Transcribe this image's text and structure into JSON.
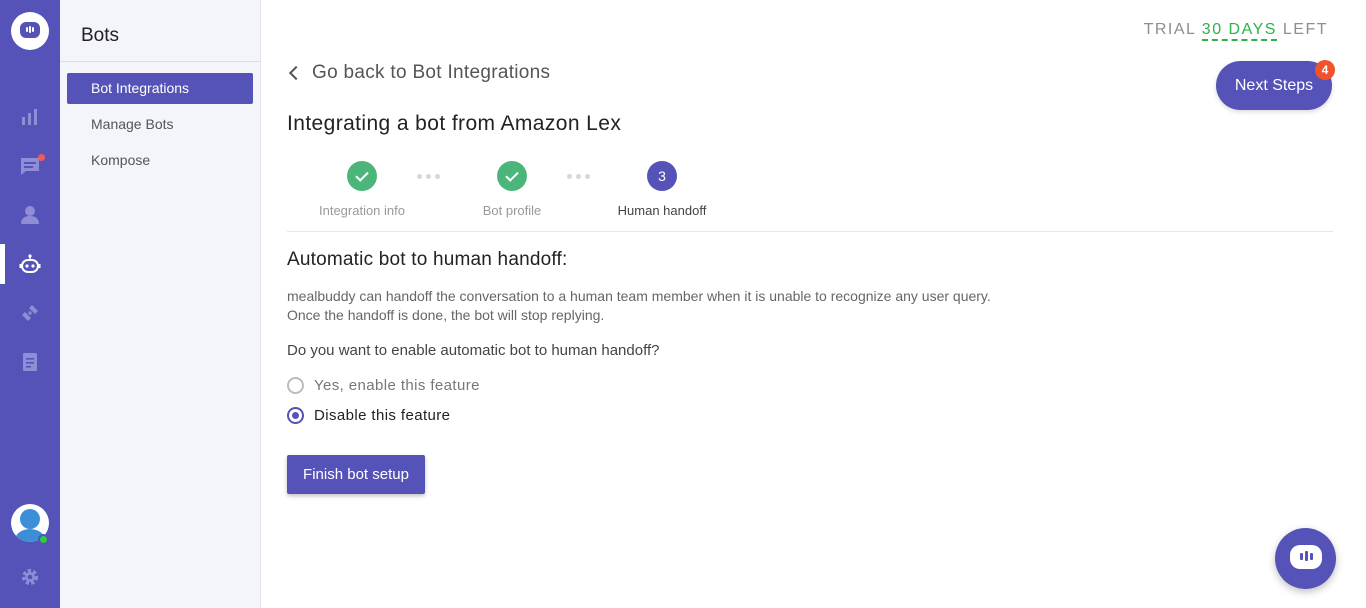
{
  "rail": {
    "items": [
      {
        "name": "reports-icon"
      },
      {
        "name": "conversations-icon"
      },
      {
        "name": "users-icon"
      },
      {
        "name": "bot-icon"
      },
      {
        "name": "integrations-icon"
      },
      {
        "name": "docs-icon"
      }
    ],
    "active": "bot-icon",
    "accent": "#5553b7"
  },
  "sidebar": {
    "title": "Bots",
    "items": [
      {
        "label": "Bot Integrations",
        "active": true
      },
      {
        "label": "Manage Bots",
        "active": false
      },
      {
        "label": "Kompose",
        "active": false
      }
    ]
  },
  "header": {
    "trial_prefix": "TRIAL",
    "trial_days": "30 DAYS",
    "trial_suffix": "LEFT",
    "next_steps_label": "Next Steps",
    "next_steps_count": "4"
  },
  "main": {
    "back_link": "Go back to Bot Integrations",
    "title": "Integrating a bot from Amazon Lex",
    "steps": [
      {
        "label": "Integration info",
        "status": "done"
      },
      {
        "label": "Bot profile",
        "status": "done"
      },
      {
        "label": "Human handoff",
        "status": "current",
        "number": "3"
      }
    ],
    "section_title": "Automatic bot to human handoff:",
    "description_line1": "mealbuddy can handoff the conversation to a human team member when it is unable to recognize any user query.",
    "description_line2": "Once the handoff is done, the bot will stop replying.",
    "question": "Do you want to enable automatic bot to human handoff?",
    "options": [
      {
        "label": "Yes, enable this feature",
        "selected": false
      },
      {
        "label": "Disable this feature",
        "selected": true
      }
    ],
    "finish_button": "Finish bot setup"
  }
}
